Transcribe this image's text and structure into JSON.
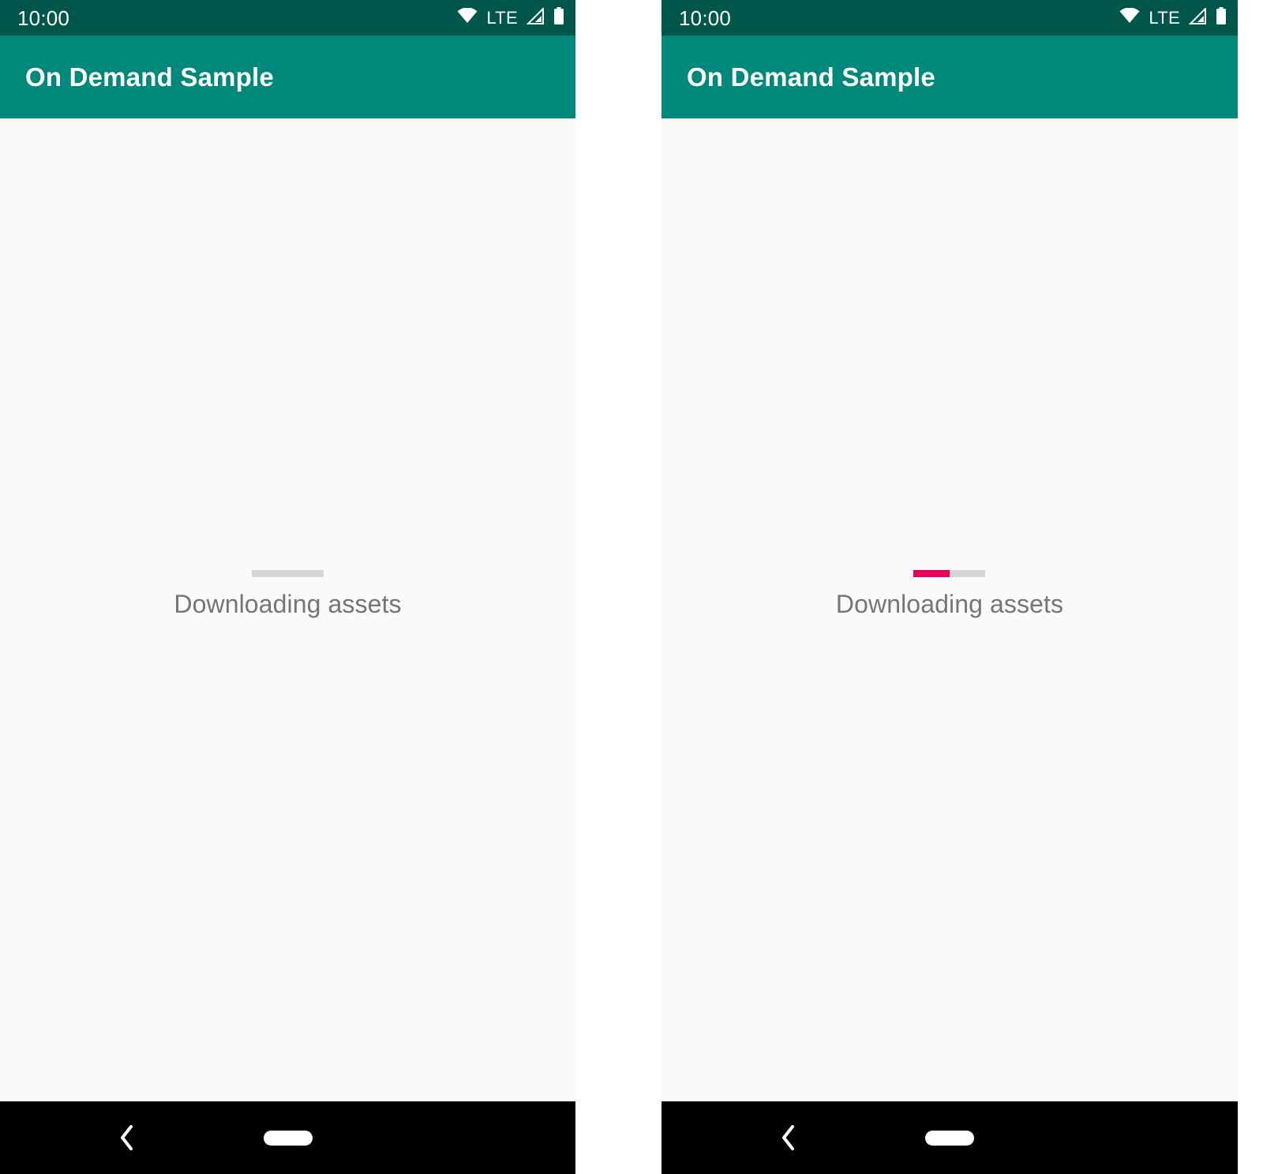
{
  "screen": {
    "background": "#ffffff",
    "body_background": "#FAFAFA",
    "accent_color": "#E8005A",
    "app_bar_color": "#00897B",
    "status_bar_color": "#00564A"
  },
  "panels": [
    {
      "id": "panel-left",
      "status_bar": {
        "clock": "10:00",
        "icons": [
          {
            "name": "wifi-icon",
            "label": "Wi-Fi"
          },
          {
            "name": "lte-label",
            "label": "LTE"
          },
          {
            "name": "cellular-signal-icon",
            "label": "Signal"
          },
          {
            "name": "battery-icon",
            "label": "Battery"
          }
        ]
      },
      "app_bar": {
        "title": "On Demand Sample"
      },
      "content": {
        "progress": {
          "value": 0,
          "max": 100,
          "fill_color": "#E8005A",
          "track_color": "#D6D6D6"
        },
        "status_text": "Downloading assets"
      },
      "nav_bar": {
        "back_label": "Back",
        "home_label": "Home"
      }
    },
    {
      "id": "panel-right",
      "status_bar": {
        "clock": "10:00",
        "icons": [
          {
            "name": "wifi-icon",
            "label": "Wi-Fi"
          },
          {
            "name": "lte-label",
            "label": "LTE"
          },
          {
            "name": "cellular-signal-icon",
            "label": "Signal"
          },
          {
            "name": "battery-icon",
            "label": "Battery"
          }
        ]
      },
      "app_bar": {
        "title": "On Demand Sample"
      },
      "content": {
        "progress": {
          "value": 50,
          "max": 100,
          "fill_color": "#E8005A",
          "track_color": "#D6D6D6"
        },
        "status_text": "Downloading assets"
      },
      "nav_bar": {
        "back_label": "Back",
        "home_label": "Home"
      }
    }
  ]
}
